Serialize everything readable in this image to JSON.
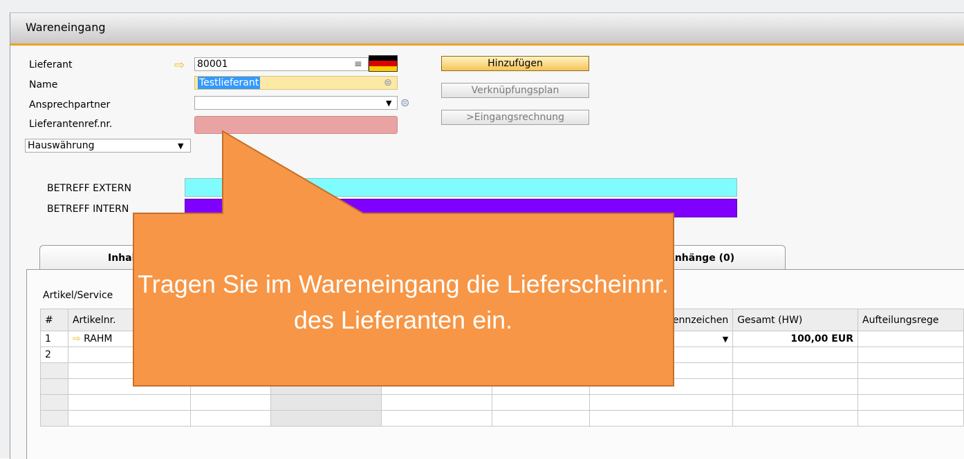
{
  "window": {
    "title": "Wareneingang"
  },
  "form": {
    "lieferant_label": "Lieferant",
    "lieferant_value": "80001",
    "name_label": "Name",
    "name_value": "Testlieferant",
    "ansprechpartner_label": "Ansprechpartner",
    "ansprechpartner_value": "",
    "lieferantenref_label": "Lieferantenref.nr.",
    "lieferantenref_value": "",
    "currency_value": "Hauswährung"
  },
  "buttons": {
    "hinzufuegen": "Hinzufügen",
    "verknuepfungsplan": "Verknüpfungsplan",
    "eingangsrechnung": ">Eingangsrechnung"
  },
  "betreff": {
    "extern_label": "BETREFF EXTERN",
    "intern_label": "BETREFF INTERN",
    "extern_color": "#7ffcfd",
    "intern_color": "#7f00ff"
  },
  "tabs": [
    {
      "label": "Inhalt"
    },
    {
      "label": "Anhänge (0)"
    }
  ],
  "grid": {
    "type_label": "Artikel/Service",
    "headers": [
      "#",
      "Artikelnr.",
      "",
      "",
      "",
      "",
      "Steuerkennzeichen",
      "Gesamt (HW)",
      "Aufteilungsrege"
    ],
    "rows": [
      {
        "num": "1",
        "item": "RAHM",
        "gesamt": "100,00 EUR"
      },
      {
        "num": "2",
        "item": "",
        "gesamt": ""
      }
    ]
  },
  "callout": {
    "text": "Tragen Sie im Wareneingang die Lieferscheinnr. des Lieferanten ein.",
    "color": "#f79646"
  },
  "colors": {
    "accent": "#f0a020",
    "lieferantenref_field": "#eaa3a3",
    "name_field": "#fde9a6"
  }
}
